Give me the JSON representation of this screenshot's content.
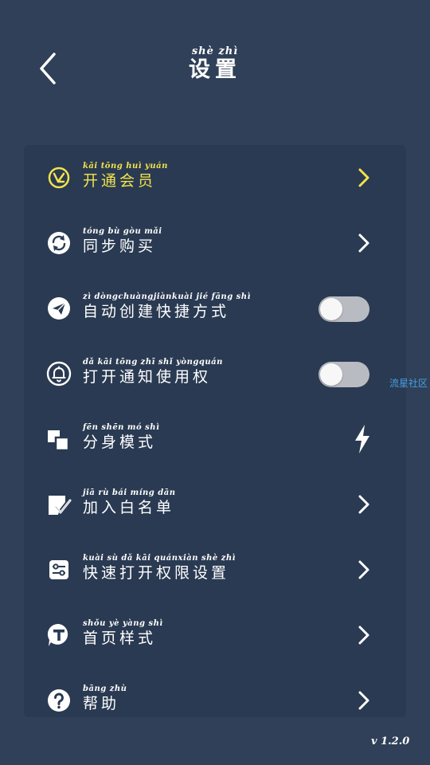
{
  "header": {
    "back_icon": "chevron-left-icon",
    "title_pinyin": "shè  zhì",
    "title": "设置"
  },
  "colors": {
    "background": "#2f4058",
    "card": "#2a3a52",
    "highlight": "#f2e34c",
    "toggle_off": "#b8bcc2",
    "watermark": "#4a9fe0"
  },
  "menu": {
    "items": [
      {
        "pinyin": "kāi tōng huì yuán",
        "label": "开通会员",
        "icon": "vip-badge-icon",
        "trailing": "chevron"
      },
      {
        "pinyin": "tóng  bù  gòu  mǎi",
        "label": "同步购买",
        "icon": "sync-icon",
        "trailing": "chevron"
      },
      {
        "pinyin": "zì  dòngchuàngjiànkuài jié fāng shì",
        "label": "自动创建快捷方式",
        "icon": "paper-plane-icon",
        "trailing": "toggle",
        "toggle_on": false
      },
      {
        "pinyin": "dǎ  kāi tōng  zhī  shǐ  yòngquán",
        "label": "打开通知使用权",
        "icon": "bell-icon",
        "trailing": "toggle",
        "toggle_on": false
      },
      {
        "pinyin": "fēn shēn  mó  shì",
        "label": "分身模式",
        "icon": "clone-icon",
        "trailing": "bolt"
      },
      {
        "pinyin": "jiā  rù  bái míng dān",
        "label": "加入白名单",
        "icon": "whitelist-check-icon",
        "trailing": "chevron"
      },
      {
        "pinyin": "kuài  sù  dǎ  kāi quánxiàn shè  zhì",
        "label": "快速打开权限设置",
        "icon": "permission-settings-icon",
        "trailing": "chevron"
      },
      {
        "pinyin": "shǒu  yè  yàng shì",
        "label": "首页样式",
        "icon": "text-style-icon",
        "trailing": "chevron"
      },
      {
        "pinyin": "bāng zhù",
        "label": "帮助",
        "icon": "help-icon",
        "trailing": "chevron"
      }
    ]
  },
  "watermark": "流星社区",
  "version": "v 1.2.0"
}
